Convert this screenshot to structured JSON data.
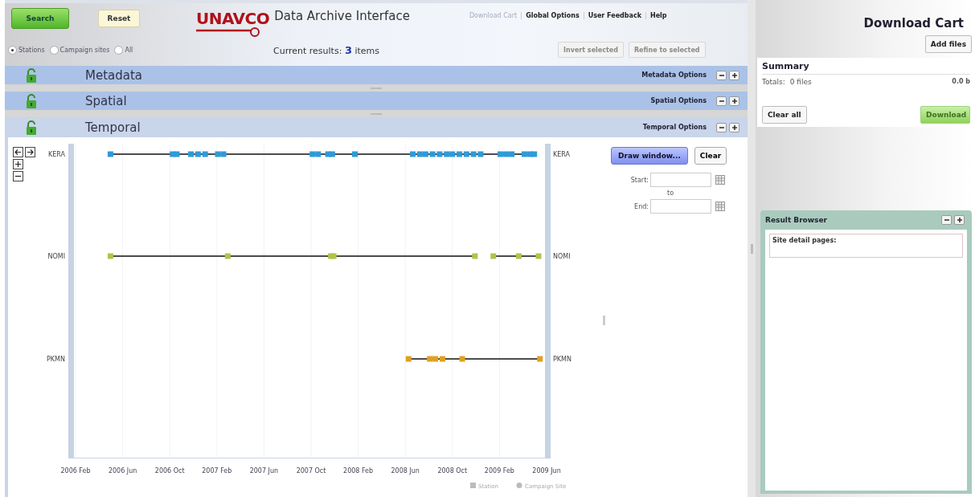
{
  "toolbar": {
    "buttons": [
      {
        "label": "Search",
        "kind": "primary"
      },
      {
        "label": "Reset",
        "kind": "secondary"
      }
    ]
  },
  "logo": {
    "brand": "UNAVCO",
    "title": "Data Archive Interface"
  },
  "nav_links": [
    {
      "label": "Download Cart",
      "disabled": true
    },
    {
      "label": "Global Options",
      "disabled": false
    },
    {
      "label": "User Feedback",
      "disabled": false
    },
    {
      "label": "Help",
      "disabled": false
    }
  ],
  "filters": [
    {
      "label": "Stations",
      "selected": true
    },
    {
      "label": "Campaign sites",
      "selected": false
    },
    {
      "label": "All",
      "selected": false
    }
  ],
  "results": {
    "label": "Current results:",
    "count": "3",
    "unit": "items"
  },
  "selection_buttons": [
    {
      "label": "Invert selected",
      "disabled": true
    },
    {
      "label": "Refine to selected",
      "disabled": true
    }
  ],
  "panels": [
    {
      "title": "Metadata",
      "options": "Metadata Options",
      "expanded": false
    },
    {
      "title": "Spatial",
      "options": "Spatial Options",
      "expanded": false
    },
    {
      "title": "Temporal",
      "options": "Temporal Options",
      "expanded": true
    }
  ],
  "temporal": {
    "timeline": {
      "rows": [
        {
          "left_label": "KERA",
          "right_label": "KERA",
          "color": "#2f9ad8"
        },
        {
          "left_label": "NOMI",
          "right_label": "NOMI",
          "color": "#b3c24a"
        },
        {
          "left_label": "PKMN",
          "right_label": "PKMN",
          "color": "#e0a020"
        }
      ],
      "axis_labels": [
        "2006 Feb",
        "2006 Jun",
        "2006 Oct",
        "2007 Feb",
        "2007 Jun",
        "2007 Oct",
        "2008 Feb",
        "2008 Jun",
        "2008 Oct",
        "2009 Feb",
        "2009 Jun"
      ]
    },
    "draw_window": "Draw window...",
    "clear": "Clear",
    "start_label": "Start:",
    "to_label": "to",
    "end_label": "End:",
    "legend": [
      {
        "label": "Station",
        "kind": "station"
      },
      {
        "label": "Campaign Site",
        "kind": "campaign"
      }
    ]
  },
  "cart": {
    "title": "Download Cart",
    "add_files": "Add files",
    "summary_title": "Summary",
    "totals_label": "Totals:",
    "files": "0 files",
    "size": "0.0 b",
    "clear_all": "Clear all",
    "download": {
      "label": "Download",
      "disabled": true
    }
  },
  "result_browser": {
    "title": "Result Browser",
    "site_detail": "Site detail pages:"
  }
}
